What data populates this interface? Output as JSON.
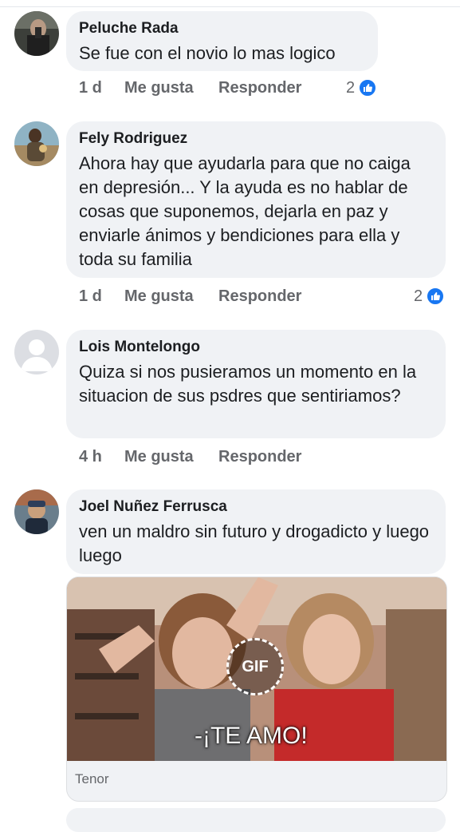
{
  "comments": [
    {
      "author": "Peluche Rada",
      "text": "Se fue con el novio lo mas logico",
      "time": "1 d",
      "like_label": "Me gusta",
      "reply_label": "Responder",
      "reaction_count": "2",
      "reaction_icon": "like-icon"
    },
    {
      "author": "Fely Rodriguez",
      "text": "Ahora hay que ayudarla para que no caiga en depresión... Y la ayuda es no hablar de cosas que suponemos, dejarla en paz y enviarle ánimos y bendiciones para ella y toda su familia",
      "time": "1 d",
      "like_label": "Me gusta",
      "reply_label": "Responder",
      "reaction_count": "2",
      "reaction_icon": "like-icon"
    },
    {
      "author": "Lois Montelongo",
      "text": "Quiza si nos pusieramos un momento en la situacion de sus psdres que sentiriamos?",
      "time": "4 h",
      "like_label": "Me gusta",
      "reply_label": "Responder"
    },
    {
      "author": "Joel Nuñez Ferrusca",
      "text": "ven un maldro sin futuro y drogadicto y luego luego",
      "gif": {
        "badge": "GIF",
        "caption": "-¡TE AMO!",
        "source": "Tenor"
      }
    }
  ],
  "colors": {
    "bubble": "#f0f2f5",
    "meta_text": "#65676b",
    "like_blue": "#1877f2"
  }
}
